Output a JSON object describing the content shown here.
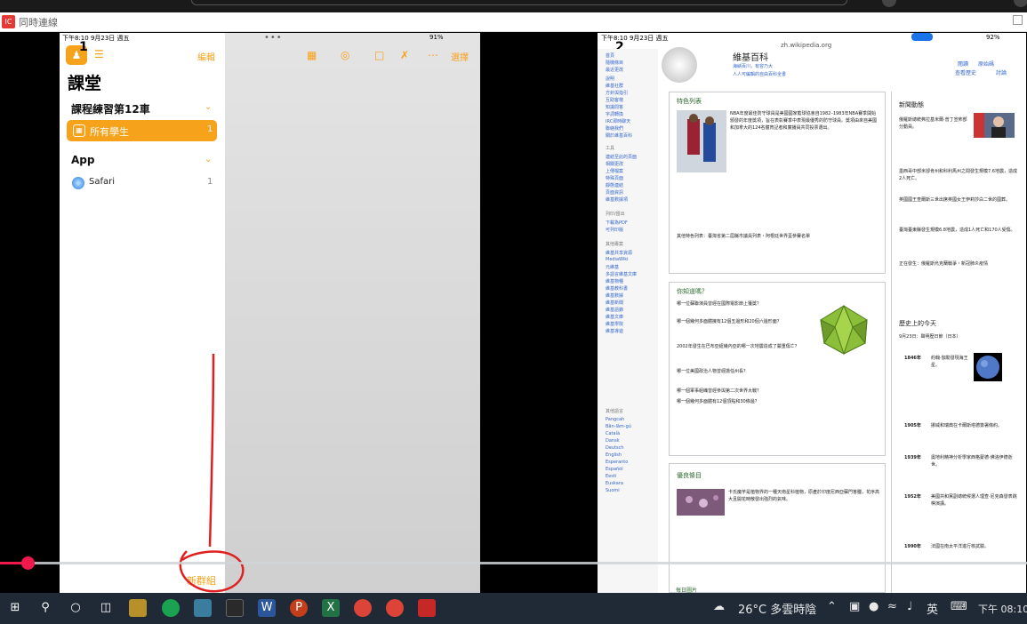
{
  "window": {
    "app_title": "同時連線",
    "app_icon_text": "IC"
  },
  "left_ipad": {
    "statusbar": {
      "time": "下午8:10 9月23日 週五",
      "battery": "91%"
    },
    "marker": "1",
    "edit_label": "編輯",
    "heading": "課堂",
    "course_section": "課程練習第12車",
    "all_students": {
      "label": "所有學生",
      "count": "1"
    },
    "app_section": "App",
    "safari": {
      "label": "Safari",
      "count": "1"
    },
    "select_label": "選擇",
    "new_group_label": "新群組",
    "dots": "•••"
  },
  "right_ipad": {
    "statusbar": {
      "time": "下午8:10 9月23日 週五",
      "battery": "92%"
    },
    "marker": "2",
    "url": "zh.wikipedia.org",
    "site_title": "維基百科",
    "site_sub1": "海納百川，有容乃大",
    "site_sub2": "人人可編輯的自由百科全書",
    "tabs": [
      "首頁",
      "討論",
      "閱讀",
      "原始碼",
      "查看歷史"
    ],
    "featured": {
      "title": "特色列表",
      "body": "NBA年度最佳防守球員是美國國家籃球協會自1982–1983年NBA賽季開始頒發的年度獎項，旨在表彰賽季中表現最優秀的防守球員。獎項由來自美國和加拿大的124名體育記者和廣播員共同投票選出。",
      "links_line": "其他特色列表：臺灣省第二屆縣市議員列表・阿根廷世界盃參賽名單"
    },
    "did_you_know": {
      "title": "你知道嗎？",
      "items": [
        "哪一位蘇聯演員曾經在國際電影節上獲獎？",
        "哪一個幾何多面體擁有12個五邊形和20個六邊形面？",
        "2002年發生在巴布亞紐幾內亞的哪一次地震造成了嚴重傷亡？",
        "哪一位美國政治人物曾經擔任州長？",
        "哪一個軍事組織曾經參與第二次世界大戰？",
        "哪一個幾何多面體有12個頂點和30條邊？"
      ]
    },
    "good_article": {
      "title": "優良條目",
      "body": "卡氏魔芋是植物界的一種天南星科植物，原產於印度尼西亞蘇門答臘，花序高大且開花時散發出強烈的氣味。"
    },
    "news": {
      "title": "新聞動態",
      "items": [
        "俄羅斯總統弗拉基米爾·普丁宣佈部分動員。",
        "墨西哥中部米卻肯州和科利馬州之間發生規模7.6地震，造成2人死亡。",
        "英國國王查爾斯三世出席英國女王伊莉莎白二世的國葬。",
        "臺灣臺東縣發生規模6.8地震，造成1人死亡和170人受傷。"
      ],
      "ongoing": "正在發生：俄羅斯烏克蘭戰爭・新冠肺炎疫情"
    },
    "on_this_day": {
      "title": "歷史上的今天",
      "date_line": "9月23日：聲明歷日節（日本）",
      "entries": [
        {
          "year": "1846年",
          "text": "約翰·伽勒發現海王星。"
        },
        {
          "year": "1905年",
          "text": "挪威和瑞典在卡爾斯塔德簽署條約。"
        },
        {
          "year": "1939年",
          "text": "奧地利精神分析學家西格蒙德·佛洛伊德逝世。"
        },
        {
          "year": "1952年",
          "text": "美國共和黨副總統候選人理查·尼克森發表跳棋演講。"
        },
        {
          "year": "1990年",
          "text": "法國在南太平洋進行核試驗。"
        }
      ]
    },
    "more_images": "每日圖片"
  },
  "taskbar": {
    "weather": "26°C 多雲時陰",
    "ime": "英",
    "clock": "下午 08:10"
  },
  "colors": {
    "ios_accent": "#f7a21b",
    "scrubber": "#f0194b",
    "taskbar": "#1f2a36",
    "annotation": "#e02020"
  }
}
